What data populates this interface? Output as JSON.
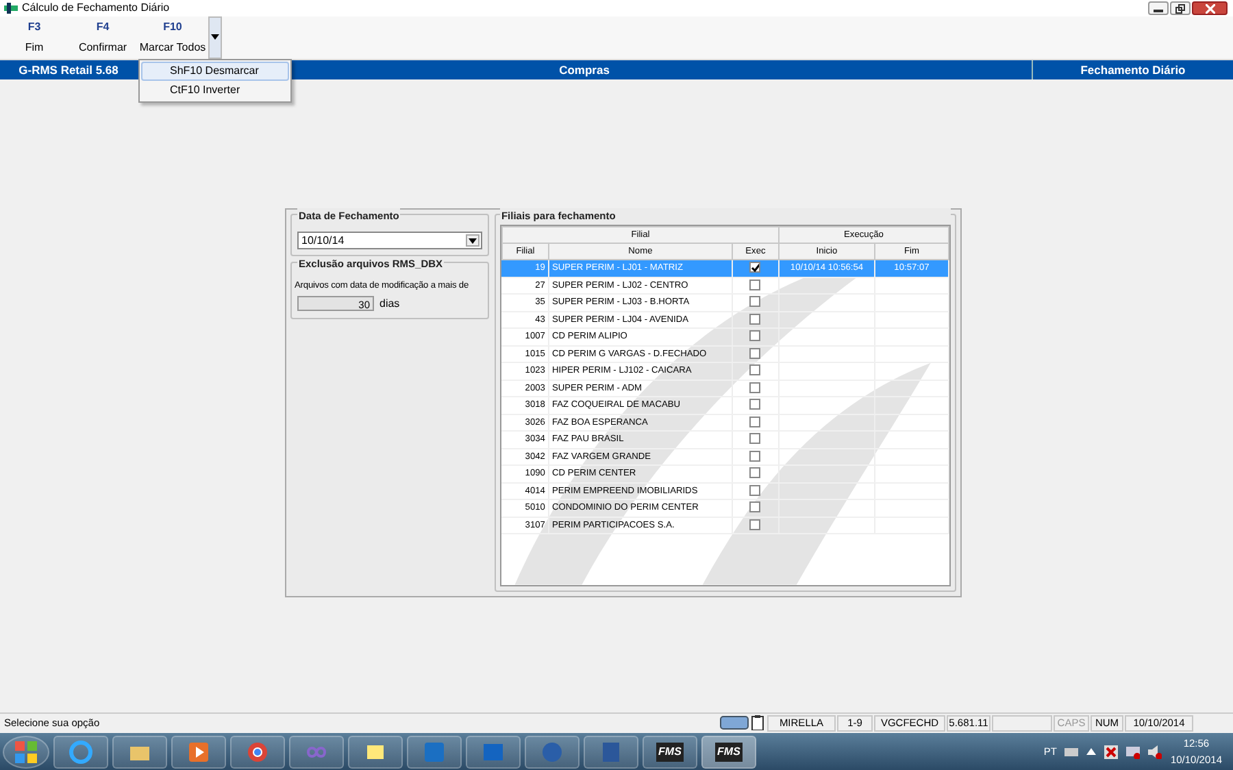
{
  "window": {
    "title": "Cálculo de Fechamento Diário"
  },
  "toolbar": [
    {
      "key": "F3",
      "label": "Fim"
    },
    {
      "key": "F4",
      "label": "Confirmar"
    },
    {
      "key": "F10",
      "label": "Marcar Todos",
      "expanded": true
    }
  ],
  "dropdown_menu": [
    {
      "label": "ShF10 Desmarcar",
      "selected": true
    },
    {
      "label": "CtF10 Inverter",
      "selected": false
    }
  ],
  "header_bar": [
    "G-RMS Retail 5.68",
    "Compras",
    "Fechamento Diário"
  ],
  "date_group": {
    "title": "Data de Fechamento",
    "value": "10/10/14"
  },
  "cleanup_group": {
    "title": "Exclusão arquivos RMS_DBX",
    "text": "Arquivos com data de modificação a mais de",
    "value": "30",
    "unit": "dias"
  },
  "branches": {
    "title": "Filiais para fechamento",
    "group_headers": [
      "Filial",
      "Execução"
    ],
    "columns": [
      "Filial",
      "Nome",
      "Exec",
      "Inicio",
      "Fim"
    ],
    "rows": [
      {
        "code": "19",
        "name": "SUPER PERIM - LJ01 - MATRIZ",
        "exec": true,
        "start": "10/10/14 10:56:54",
        "end": "10:57:07",
        "selected": true
      },
      {
        "code": "27",
        "name": "SUPER PERIM - LJ02 - CENTRO",
        "exec": false,
        "selected": false
      },
      {
        "code": "35",
        "name": "SUPER PERIM - LJ03 - B.HORTA",
        "exec": false,
        "selected": false
      },
      {
        "code": "43",
        "name": "SUPER PERIM - LJ04 - AVENIDA",
        "exec": false,
        "selected": false
      },
      {
        "code": "1007",
        "name": "CD PERIM ALIPIO",
        "exec": false,
        "selected": false
      },
      {
        "code": "1015",
        "name": "CD PERIM G VARGAS - D.FECHADO",
        "exec": false,
        "selected": false
      },
      {
        "code": "1023",
        "name": "HIPER PERIM - LJ102 - CAICARA",
        "exec": false,
        "selected": false
      },
      {
        "code": "2003",
        "name": "SUPER PERIM - ADM",
        "exec": false,
        "selected": false
      },
      {
        "code": "3018",
        "name": "FAZ COQUEIRAL DE MACABU",
        "exec": false,
        "selected": false
      },
      {
        "code": "3026",
        "name": "FAZ BOA ESPERANCA",
        "exec": false,
        "selected": false
      },
      {
        "code": "3034",
        "name": "FAZ PAU BRASIL",
        "exec": false,
        "selected": false
      },
      {
        "code": "3042",
        "name": "FAZ VARGEM GRANDE",
        "exec": false,
        "selected": false
      },
      {
        "code": "1090",
        "name": "CD PERIM CENTER",
        "exec": false,
        "selected": false
      },
      {
        "code": "4014",
        "name": "PERIM EMPREEND IMOBILIARIDS",
        "exec": false,
        "selected": false
      },
      {
        "code": "5010",
        "name": "CONDOMINIO DO PERIM CENTER",
        "exec": false,
        "selected": false
      },
      {
        "code": "3107",
        "name": "PERIM PARTICIPACOES S.A.",
        "exec": false,
        "selected": false
      }
    ]
  },
  "status_bar": {
    "message": "Selecione sua opção",
    "panels": [
      {
        "text": "MIRELLA",
        "on": true
      },
      {
        "text": "1-9",
        "on": true
      },
      {
        "text": "VGCFECHD",
        "on": true
      },
      {
        "text": "5.681.11",
        "on": true
      },
      {
        "text": "CAPS",
        "on": false
      },
      {
        "text": "NUM",
        "on": true
      },
      {
        "text": "10/10/2014",
        "on": true
      }
    ]
  },
  "taskbar": {
    "apps": [
      {
        "label": "FMS",
        "selected": false
      },
      {
        "label": "FMS",
        "selected": true
      }
    ],
    "language": "PT",
    "time": "12:56",
    "date": "10/10/2014"
  }
}
